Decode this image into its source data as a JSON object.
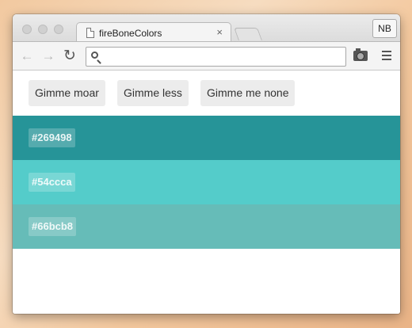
{
  "window": {
    "tab_title": "fireBoneColors",
    "tab_close": "×",
    "profile_label": "NB"
  },
  "toolbar": {
    "back_icon": "←",
    "forward_icon": "→",
    "reload_icon": "↻",
    "omnibox_value": ""
  },
  "buttons": {
    "more": "Gimme moar",
    "less": "Gimme less",
    "none": "Gimme me none"
  },
  "swatches": [
    {
      "hex": "#269498",
      "color": "#269498"
    },
    {
      "hex": "#54ccca",
      "color": "#54ccca"
    },
    {
      "hex": "#66bcb8",
      "color": "#66bcb8"
    }
  ]
}
